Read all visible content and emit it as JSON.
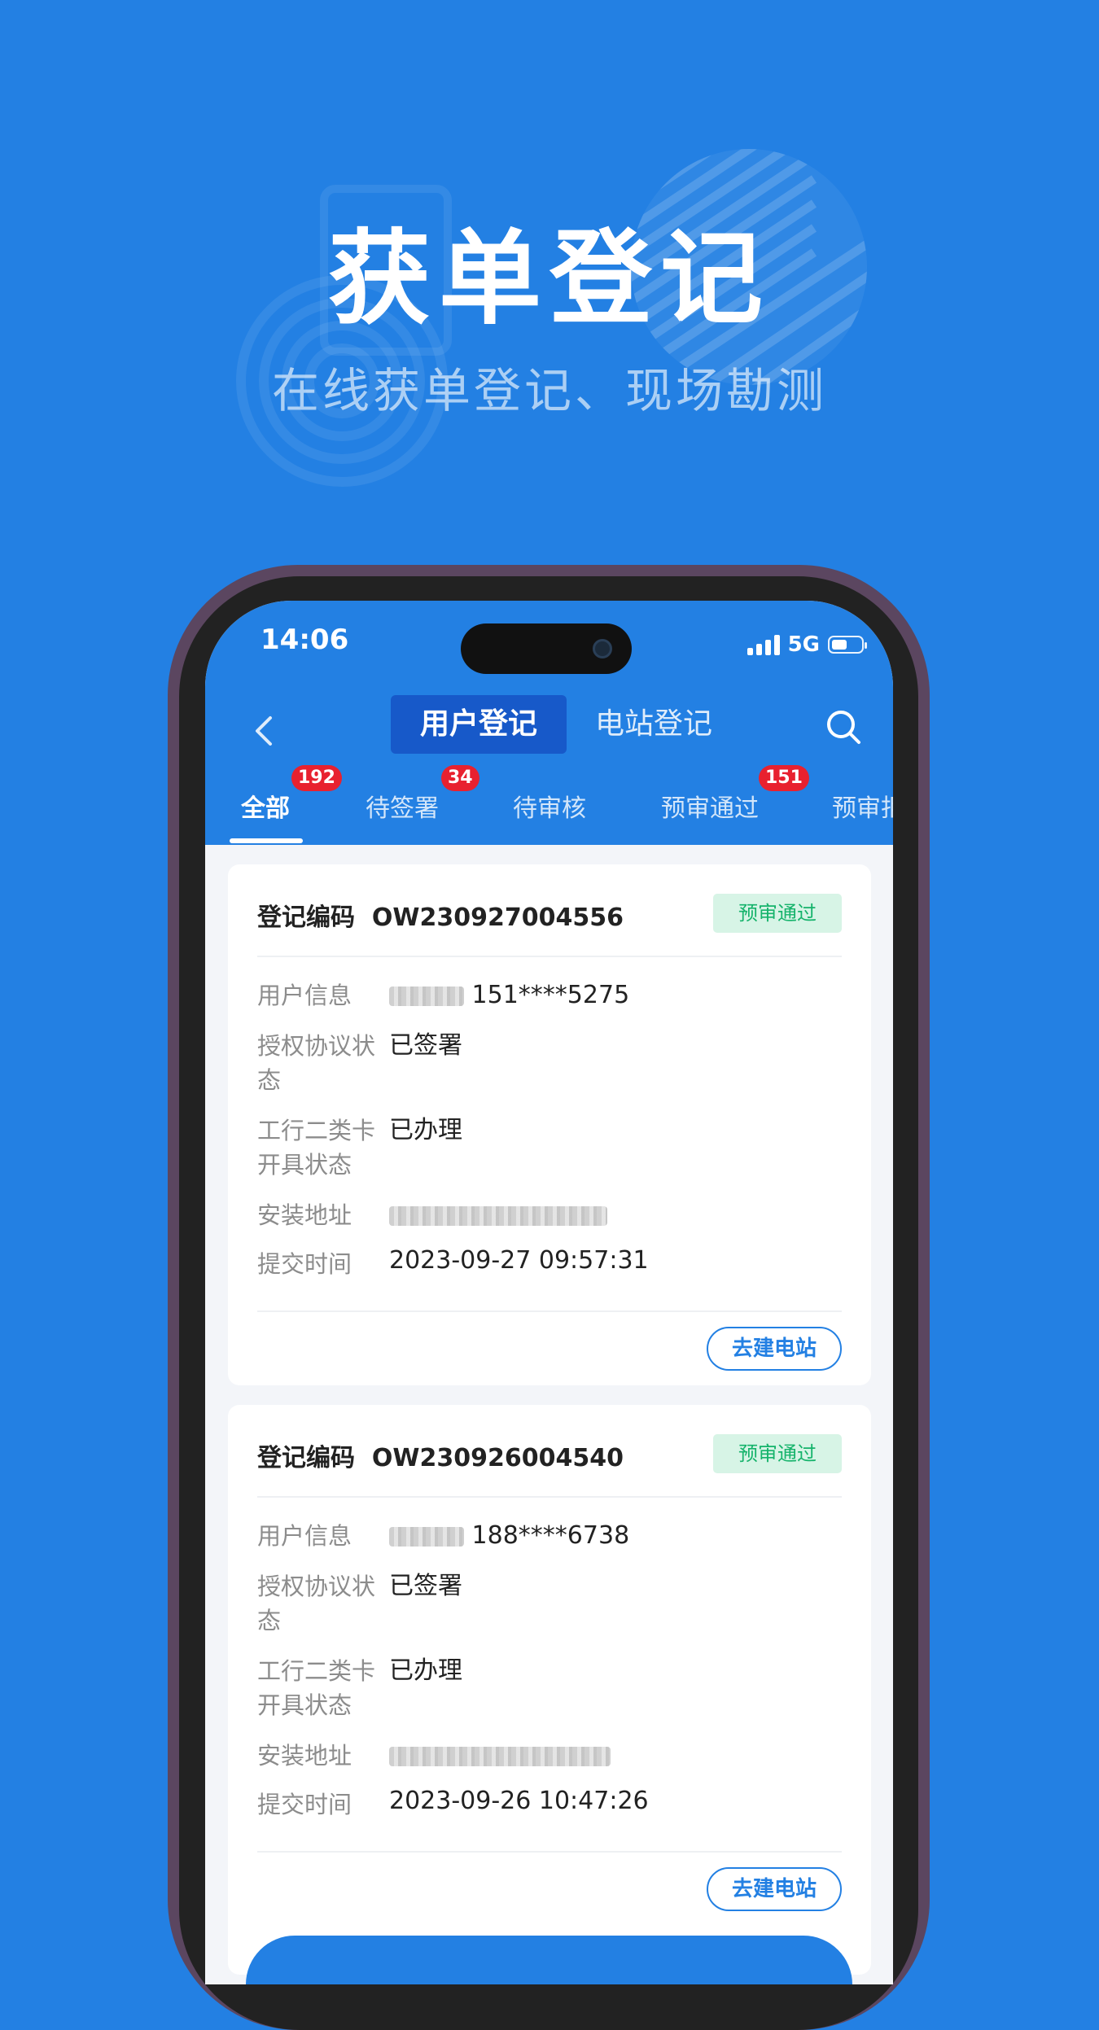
{
  "hero": {
    "title": "获单登记",
    "subtitle": "在线获单登记、现场勘测"
  },
  "status_bar": {
    "time": "14:06",
    "network": "5G"
  },
  "header": {
    "segment_active": "用户登记",
    "segment_inactive": "电站登记"
  },
  "tabs": [
    {
      "label": "全部",
      "badge": "192",
      "active": true
    },
    {
      "label": "待签署",
      "badge": "34"
    },
    {
      "label": "待审核",
      "badge": ""
    },
    {
      "label": "预审通过",
      "badge": "151"
    },
    {
      "label": "预审拒",
      "badge": ""
    }
  ],
  "labels": {
    "code_prefix": "登记编码",
    "user_info": "用户信息",
    "auth_status_1": "授权协议状",
    "auth_status_2": "态",
    "card_status_1": "工行二类卡",
    "card_status_2": "开具状态",
    "address": "安装地址",
    "submit_time": "提交时间"
  },
  "cards": [
    {
      "code": "OW230927004556",
      "status": "预审通过",
      "phone": "151****5275",
      "auth_status": "已签署",
      "card_status": "已办理",
      "submit_time": "2023-09-27 09:57:31",
      "action": "去建电站"
    },
    {
      "code": "OW230926004540",
      "status": "预审通过",
      "phone": "188****6738",
      "auth_status": "已签署",
      "card_status": "已办理",
      "submit_time": "2023-09-26 10:47:26",
      "action": "去建电站"
    }
  ],
  "colors": {
    "brand_blue": "#2380e3",
    "segment_active": "#1759c9",
    "badge_red": "#e8212f",
    "status_green": "#15b36b",
    "status_green_bg": "#d7f4e6"
  },
  "icons": [
    "back-chevron-icon",
    "search-icon",
    "signal-icon",
    "battery-icon"
  ]
}
